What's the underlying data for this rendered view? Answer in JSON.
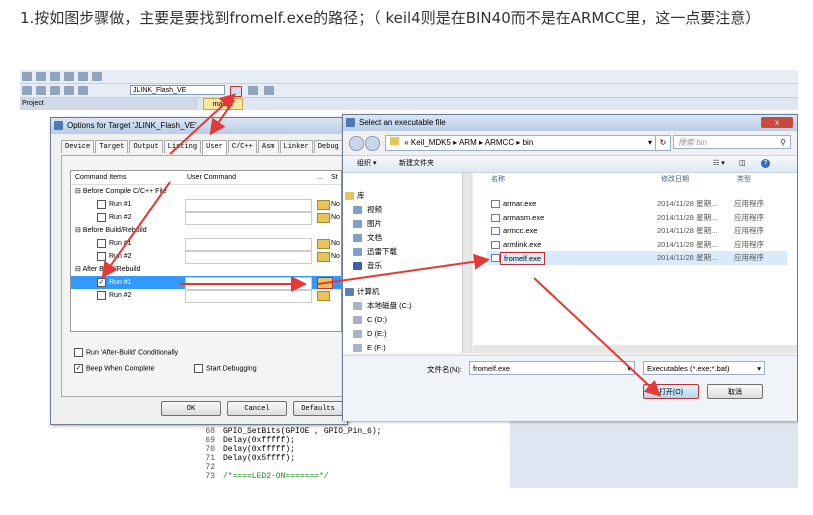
{
  "caption": "1.按如图步骤做，主要是要找到fromelf.exe的路径；（ keil4则是在BIN40而不是在ARMCC里，这一点要注意）",
  "ide": {
    "target_select": "JLINK_Flash_VE",
    "project_label": "Project",
    "project_tab_pin": "ф",
    "editor_tab": "main.c",
    "code_lines": [
      {
        "num": "68",
        "text": "GPIO_SetBits(GPIOE , GPIO_Pin_6);"
      },
      {
        "num": "69",
        "text": "Delay(0xfffff);"
      },
      {
        "num": "70",
        "text": "Delay(0xfffff);"
      },
      {
        "num": "71",
        "text": "Delay(0x5ffff);"
      },
      {
        "num": "72",
        "text": ""
      },
      {
        "num": "73",
        "text": "/*====LED2-ON=======*/"
      }
    ]
  },
  "options_dialog": {
    "title": "Options for Target 'JLINK_Flash_VE'",
    "tabs": [
      "Device",
      "Target",
      "Output",
      "Listing",
      "User",
      "C/C++",
      "Asm",
      "Linker",
      "Debug"
    ],
    "active_tab": "User",
    "col_command_items": "Command Items",
    "col_user_command": "User Command",
    "col_extra": "...",
    "col_st": "St",
    "groups": [
      {
        "label": "Before Compile C/C++ File",
        "runs": [
          {
            "label": "Run #1",
            "na": "No"
          },
          {
            "label": "Run #2",
            "na": "No"
          }
        ]
      },
      {
        "label": "Before Build/Rebuild",
        "runs": [
          {
            "label": "Run #1",
            "na": "No"
          },
          {
            "label": "Run #2",
            "na": "No"
          }
        ]
      },
      {
        "label": "After Build/Rebuild",
        "runs": [
          {
            "label": "Run #1",
            "na": ""
          },
          {
            "label": "Run #2",
            "na": ""
          }
        ]
      }
    ],
    "check_conditionally": "Run 'After-Build' Conditionally",
    "check_beep": "Beep When Complete",
    "check_start_debug": "Start Debugging",
    "ok": "OK",
    "cancel": "Cancel",
    "defaults": "Defaults"
  },
  "file_dialog": {
    "title": "Select an executable file",
    "close": "x",
    "path": [
      "Keil_MDK5",
      "ARM",
      "ARMCC",
      "bin"
    ],
    "path_prefix": "«",
    "search_placeholder": "搜索 bin",
    "organize": "组织 ▾",
    "new_folder": "新建文件夹",
    "nav": [
      "库",
      "视频",
      "图片",
      "文档",
      "迅雷下载",
      "音乐",
      "计算机",
      "本地磁盘 (C:)",
      "C (D:)",
      "D (E:)",
      "E (F:)"
    ],
    "col_name": "名称",
    "col_date": "修改日期",
    "col_type": "类型",
    "files": [
      {
        "name": "armar.exe",
        "date": "2014/11/28 星期...",
        "type": "应用程序"
      },
      {
        "name": "armasm.exe",
        "date": "2014/11/28 星期...",
        "type": "应用程序"
      },
      {
        "name": "armcc.exe",
        "date": "2014/11/28 星期...",
        "type": "应用程序"
      },
      {
        "name": "armlink.exe",
        "date": "2014/11/28 星期...",
        "type": "应用程序"
      },
      {
        "name": "fromelf.exe",
        "date": "2014/11/28 星期...",
        "type": "应用程序"
      }
    ],
    "filename_label": "文件名(N):",
    "filename_value": "fromelf.exe",
    "filter": "Executables (*.exe;*.bat)",
    "open": "打开(O)",
    "cancel": "取消"
  },
  "colors": {
    "annotation_arrow": "#e53935",
    "accent": "#3c7fb1"
  }
}
